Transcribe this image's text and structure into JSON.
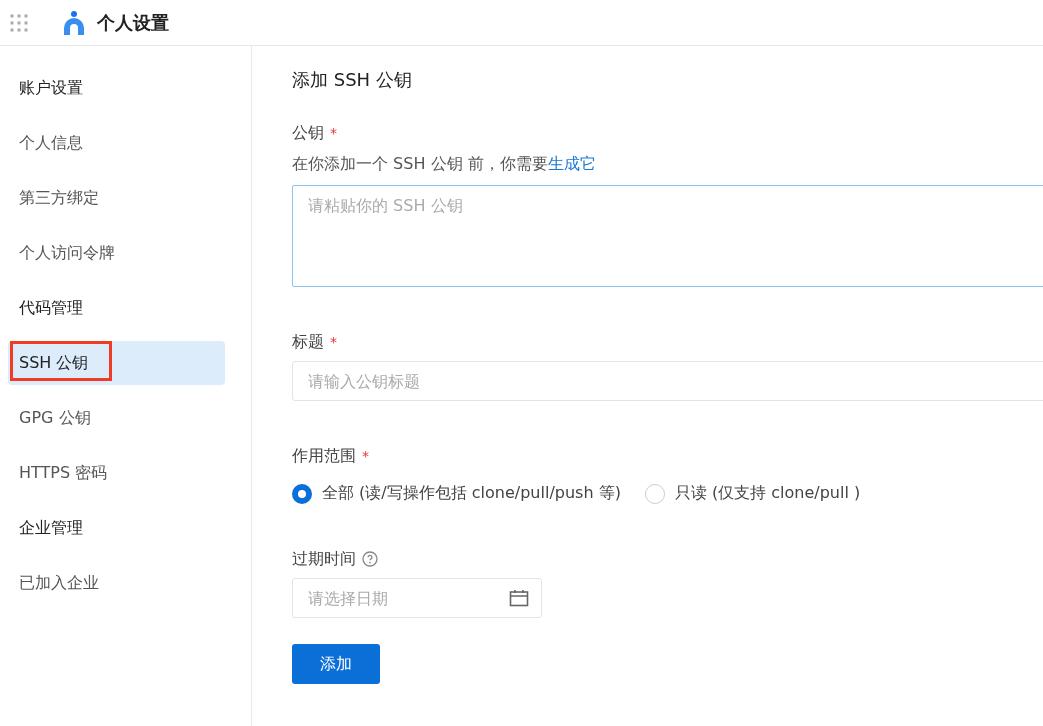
{
  "header": {
    "title": "个人设置"
  },
  "sidebar": {
    "items": [
      {
        "kind": "group",
        "label": "账户设置",
        "selected": false,
        "annotated": false
      },
      {
        "kind": "item",
        "label": "个人信息",
        "selected": false,
        "annotated": false
      },
      {
        "kind": "item",
        "label": "第三方绑定",
        "selected": false,
        "annotated": false
      },
      {
        "kind": "item",
        "label": "个人访问令牌",
        "selected": false,
        "annotated": false
      },
      {
        "kind": "group",
        "label": "代码管理",
        "selected": false,
        "annotated": false
      },
      {
        "kind": "item",
        "label": "SSH 公钥",
        "selected": true,
        "annotated": true
      },
      {
        "kind": "item",
        "label": "GPG 公钥",
        "selected": false,
        "annotated": false
      },
      {
        "kind": "item",
        "label": "HTTPS 密码",
        "selected": false,
        "annotated": false
      },
      {
        "kind": "group",
        "label": "企业管理",
        "selected": false,
        "annotated": false
      },
      {
        "kind": "item",
        "label": "已加入企业",
        "selected": false,
        "annotated": false
      }
    ]
  },
  "form": {
    "title": "添加 SSH 公钥",
    "public_key": {
      "label": "公钥",
      "required_mark": "*",
      "description": "在你添加一个 SSH 公钥 前，你需要",
      "link": "生成它",
      "placeholder": "请粘贴你的 SSH 公钥"
    },
    "key_title": {
      "label": "标题",
      "required_mark": "*",
      "placeholder": "请输入公钥标题"
    },
    "scope": {
      "label": "作用范围",
      "required_mark": "*",
      "options": [
        {
          "label": "全部 (读/写操作包括 clone/pull/push 等)",
          "selected": true
        },
        {
          "label": "只读 (仅支持 clone/pull )",
          "selected": false
        }
      ]
    },
    "expiry": {
      "label": "过期时间",
      "placeholder": "请选择日期"
    },
    "submit": "添加"
  }
}
